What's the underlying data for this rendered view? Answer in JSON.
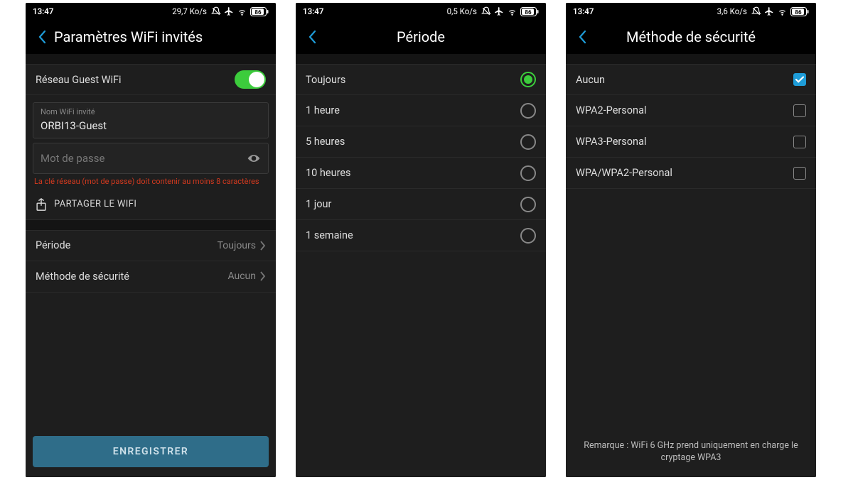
{
  "status": {
    "time": "13:47",
    "rates": {
      "s1": "29,7 Ko/s",
      "s2": "0,5 Ko/s",
      "s3": "3,6 Ko/s"
    },
    "battery": "86"
  },
  "screen1": {
    "title": "Paramètres WiFi invités",
    "guest_toggle_label": "Réseau Guest WiFi",
    "ssid_floating": "Nom WiFi invité",
    "ssid_value": "ORBI13-Guest",
    "password_placeholder": "Mot de passe",
    "password_error": "La clé réseau (mot de passe) doit contenir au moins 8 caractères",
    "share_label": "PARTAGER LE WIFI",
    "period_label": "Période",
    "period_value": "Toujours",
    "security_label": "Méthode de sécurité",
    "security_value": "Aucun",
    "save_label": "ENREGISTRER"
  },
  "screen2": {
    "title": "Période",
    "options": {
      "o0": "Toujours",
      "o1": "1 heure",
      "o2": "5 heures",
      "o3": "10 heures",
      "o4": "1 jour",
      "o5": "1 semaine"
    }
  },
  "screen3": {
    "title": "Méthode de sécurité",
    "options": {
      "o0": "Aucun",
      "o1": "WPA2-Personal",
      "o2": "WPA3-Personal",
      "o3": "WPA/WPA2-Personal"
    },
    "note": "Remarque : WiFi 6 GHz prend uniquement en charge le cryptage WPA3"
  }
}
